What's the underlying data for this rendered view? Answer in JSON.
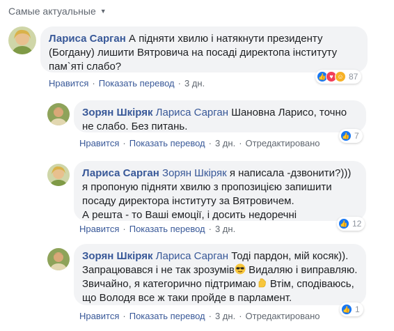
{
  "sort_label": "Самые актуальные",
  "comments": [
    {
      "author": "Лариса Сарган",
      "text_parts": [
        "А підняти хвилю і натякнути президенту (Богдану) лишити Вятровича на посаді директопа інституту пам`яті слабо?"
      ],
      "actions": {
        "like": "Нравится",
        "translate": "Показать перевод",
        "time": "3 дн."
      },
      "reaction_count": "87"
    },
    {
      "author": "Зорян Шкіряк",
      "mention": "Лариса Сарган",
      "text": "Шановна Ларисо, точно не слабо. Без питань.",
      "actions": {
        "like": "Нравится",
        "translate": "Показать перевод",
        "time": "3 дн.",
        "edited": "Отредактировано"
      },
      "reaction_count": "7"
    },
    {
      "author": "Лариса Сарган",
      "mention": "Зорян Шкіряк",
      "text1": "я написала -дзвонити?))) я пропоную підняти хвилю з пропозицією запишити посаду директора інституту за Вятровичем.",
      "text2": "А решта - то Ваші емоції, і досить недоречні",
      "actions": {
        "like": "Нравится",
        "translate": "Показать перевод",
        "time": "3 дн."
      },
      "reaction_count": "12"
    },
    {
      "author": "Зорян Шкіряк",
      "mention": "Лариса Сарган",
      "text_a": "Тоді пардон, мій косяк)). Запрацювався і не так зрозумів",
      "text_b": " Видаляю і виправляю. Звичайно, я категорично підтримаю",
      "text_c": " Втім, сподіваюсь, що Володя все ж таки пройде в парламент.",
      "actions": {
        "like": "Нравится",
        "translate": "Показать перевод",
        "time": "3 дн.",
        "edited": "Отредактировано"
      },
      "reaction_count": "1"
    }
  ],
  "colors": {
    "link": "#385898",
    "bubble": "#f2f3f5",
    "like": "#1877f2",
    "love": "#f33e58",
    "haha": "#f7b125"
  }
}
